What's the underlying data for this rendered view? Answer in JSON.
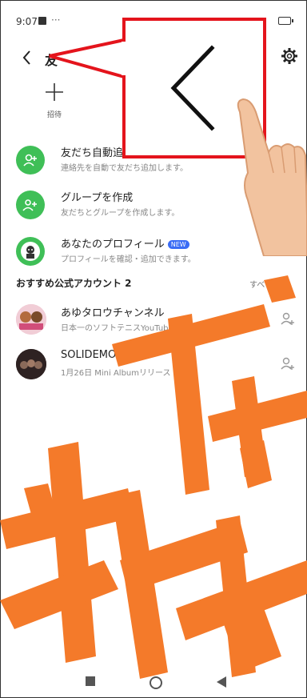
{
  "status_bar": {
    "time": "9:07",
    "extra": "···"
  },
  "header": {
    "title": "友"
  },
  "invite": {
    "label": "招待"
  },
  "rows": [
    {
      "title": "友だち自動追加",
      "subtitle": "連絡先を自動で友だち追加します。"
    },
    {
      "title": "グループを作成",
      "subtitle": "友だちとグループを作成します。"
    },
    {
      "title": "あなたのプロフィール",
      "badge": "NEW",
      "subtitle": "プロフィールを確認・追加できます。"
    }
  ],
  "recommended": {
    "heading": "おすすめ公式アカウント 2",
    "see_all": "すべて見る",
    "accounts": [
      {
        "name": "あゆタロウチャンネル",
        "desc": "日本一のソフトテニスYouTuber"
      },
      {
        "name": "SOLIDEMO",
        "desc": "1月26日 Mini Albumリリース"
      }
    ]
  },
  "colors": {
    "accent_green": "#3fbf57",
    "callout_red": "#e4141c",
    "watermark_orange": "#f47a2a"
  },
  "icons": [
    "back-icon",
    "gear-icon",
    "plus-icon",
    "add-friend-icon",
    "stop-icon",
    "home-icon",
    "back-triangle-icon",
    "pointing-hand-icon"
  ]
}
